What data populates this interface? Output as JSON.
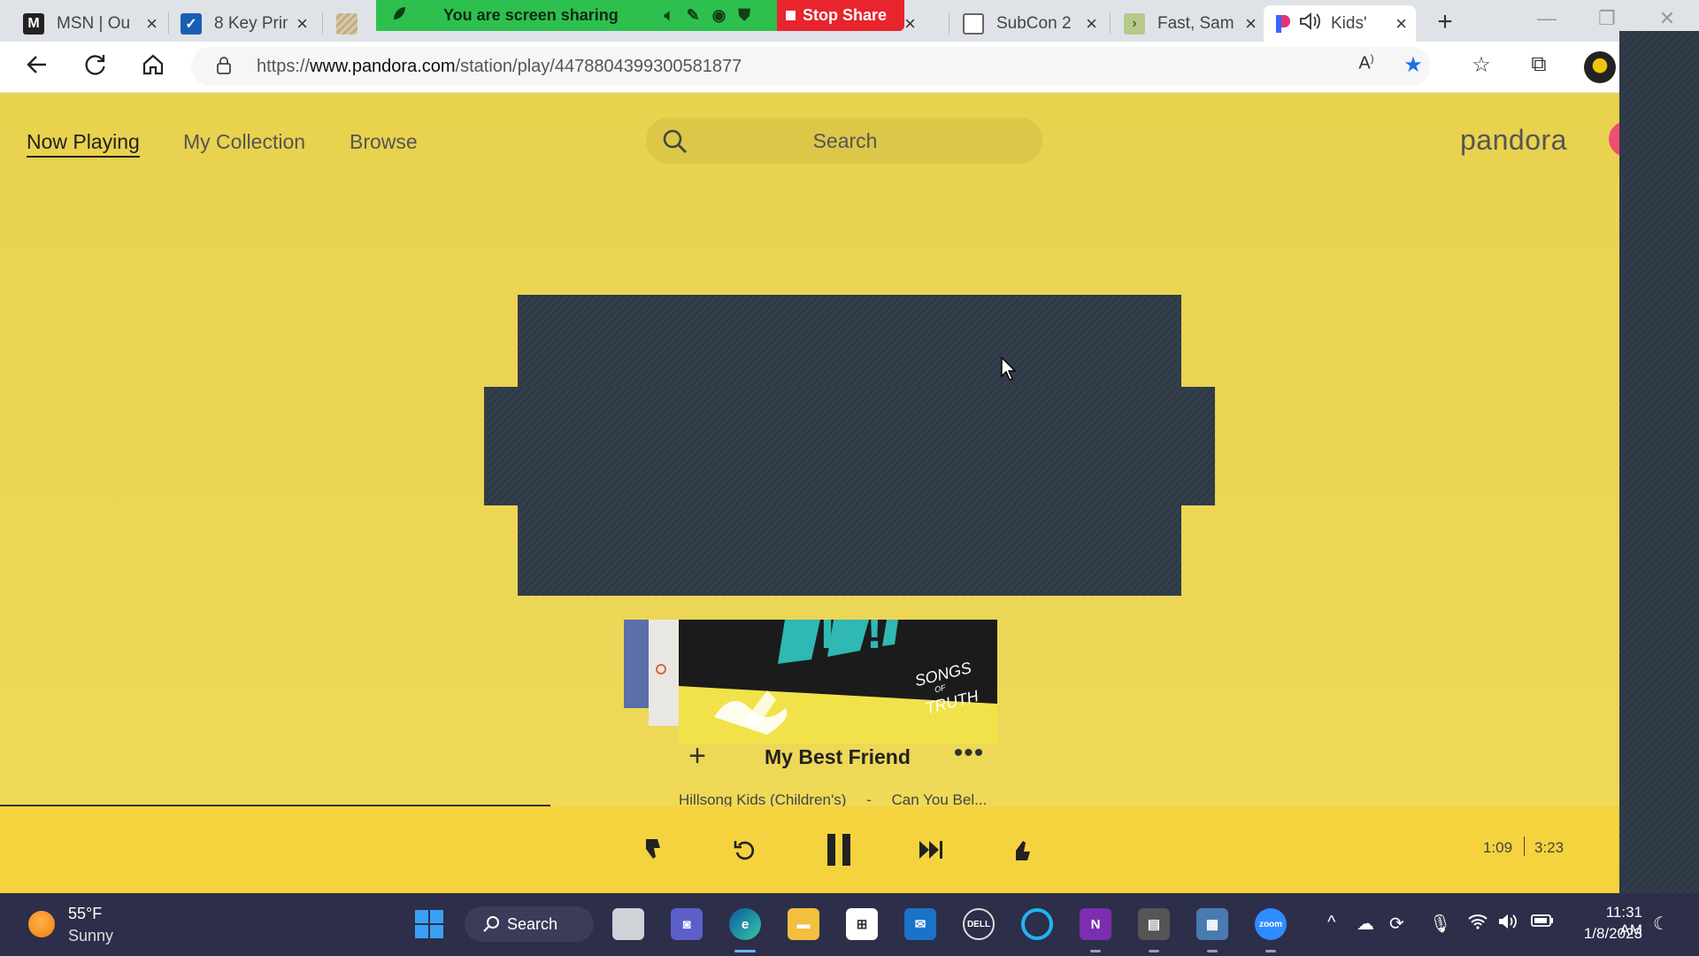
{
  "browser": {
    "tabs": [
      {
        "title": "MSN | Ou",
        "icon": "msn-icon"
      },
      {
        "title": "8 Key Prin",
        "icon": "checkmark-icon"
      },
      {
        "title": "",
        "icon": "stripes-icon"
      },
      {
        "title": "SubCon 2",
        "icon": "page-icon"
      },
      {
        "title": "Fast, Sam",
        "icon": "chevron-icon"
      },
      {
        "title": "Kids'",
        "icon": "pandora-icon"
      }
    ],
    "share_bar": {
      "message": "You are screen sharing",
      "stop_label": "Stop Share"
    },
    "url": "https://www.pandora.com/station/play/4478804399300581877",
    "url_host": "www.pandora.com",
    "url_scheme": "https://",
    "url_path": "/station/play/4478804399300581877"
  },
  "pandora": {
    "nav": {
      "now_playing": "Now Playing",
      "my_collection": "My Collection",
      "browse": "Browse"
    },
    "search_placeholder": "Search",
    "logo": "pandora",
    "album_text": "SONGS OF TRUTH",
    "album_text_lines": [
      "SONGS",
      "OF",
      "TRUTH"
    ],
    "album_big_text": "IT!",
    "track": {
      "title": "My Best Friend",
      "artist": "Hillsong Kids (Children's)",
      "separator": "-",
      "album": "Can You Bel..."
    },
    "progress": {
      "elapsed": "1:09",
      "total": "3:23",
      "fraction": 0.34
    }
  },
  "taskbar": {
    "weather_temp": "55°F",
    "weather_cond": "Sunny",
    "search_label": "Search",
    "time": "11:31 AM",
    "date": "1/8/2023"
  },
  "colors": {
    "pandora_yellow": "#ecd655",
    "playbar_yellow": "#f5d33f",
    "share_green": "#2ec04f",
    "stop_red": "#e8242c",
    "overlay": "#2f3946",
    "taskbar": "#2d2e4a"
  }
}
